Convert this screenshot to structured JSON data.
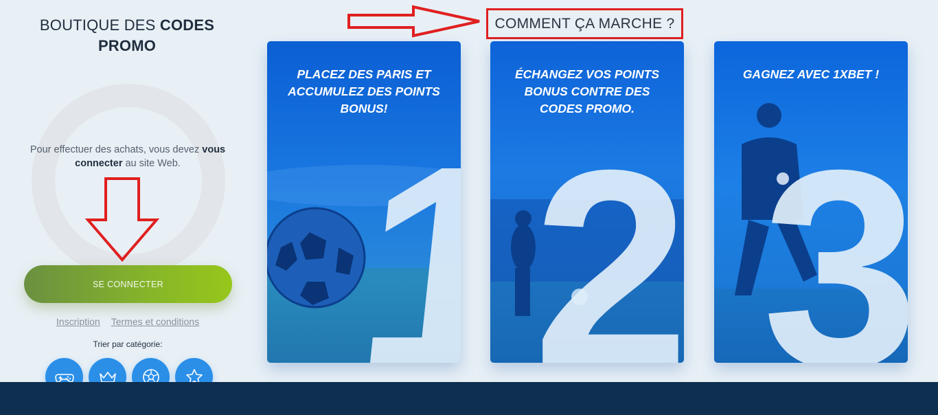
{
  "shop": {
    "title_regular": "BOUTIQUE DES ",
    "title_bold": "CODES PROMO"
  },
  "login": {
    "message_prefix": "Pour effectuer des achats, vous devez ",
    "message_bold": "vous connecter",
    "message_suffix": " au site Web.",
    "button_label": "SE CONNECTER"
  },
  "links": {
    "register": "Inscription",
    "terms": "Termes et conditions"
  },
  "sort": {
    "label": "Trier par catégorie:",
    "categories": [
      {
        "icon": "gamepad-icon"
      },
      {
        "icon": "crown-icon"
      },
      {
        "icon": "soccer-ball-icon"
      },
      {
        "icon": "star-icon"
      }
    ]
  },
  "how": {
    "title": "COMMENT ÇA MARCHE ?"
  },
  "steps": [
    {
      "number": "1",
      "title": "PLACEZ DES PARIS ET ACCUMULEZ DES POINTS BONUS!"
    },
    {
      "number": "2",
      "title": "ÉCHANGEZ VOS POINTS BONUS CONTRE DES CODES PROMO."
    },
    {
      "number": "3",
      "title": "GAGNEZ AVEC 1XBET !"
    }
  ],
  "colors": {
    "accent_green": "#86b52a",
    "category_blue": "#2b8fe8",
    "card_blue": "#1a78e0",
    "annotation_red": "#e02020",
    "footer": "#0e2f4f"
  }
}
